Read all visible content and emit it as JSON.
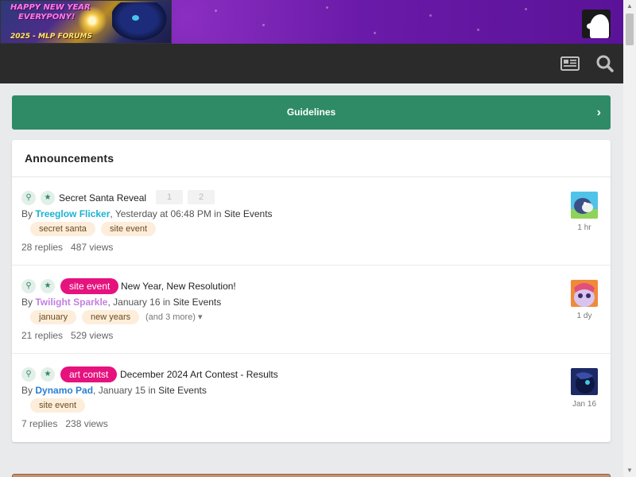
{
  "header": {
    "logo_line1": "HAPPY NEW YEAR",
    "logo_line2": "EVERYPONY!",
    "logo_line3": "2025 - MLP FORUMS"
  },
  "guidelines": {
    "label": "Guidelines",
    "chevron": "›"
  },
  "announcements": {
    "title": "Announcements",
    "topics": [
      {
        "title": "Secret Santa Reveal",
        "prefix": null,
        "pages": [
          "1",
          "2"
        ],
        "by": "By",
        "author": "Treeglow Flicker",
        "author_color": "#1ab4d2",
        "time": ", Yesterday at 06:48 PM",
        "in": "in",
        "forum": "Site Events",
        "tags": [
          "secret santa",
          "site event"
        ],
        "more_tags": "",
        "replies": "28 replies",
        "views": "487 views",
        "last_time": "1 hr"
      },
      {
        "title": "New Year, New Resolution!",
        "prefix": "site event",
        "by": "By",
        "author": "Twilight Sparkle",
        "author_color": "#c27fe0",
        "time": ", January 16",
        "in": "in",
        "forum": "Site Events",
        "tags": [
          "january",
          "new years"
        ],
        "more_tags": "(and 3 more)",
        "replies": "21 replies",
        "views": "529 views",
        "last_time": "1 dy"
      },
      {
        "title": "December 2024 Art Contest - Results",
        "prefix": "art contst",
        "by": "By",
        "author": "Dynamo Pad",
        "author_color": "#2a7fd1",
        "time": ", January 15",
        "in": "in",
        "forum": "Site Events",
        "tags": [
          "site event"
        ],
        "more_tags": "",
        "replies": "7 replies",
        "views": "238 views",
        "last_time": "Jan 16"
      }
    ]
  },
  "colors": {
    "header_purple": "#6a1aa8",
    "nav_dark": "#2b2b2b",
    "guidelines_green": "#2e8b66",
    "prefix_pink": "#e6127e",
    "tag_bg": "#fdeedb"
  },
  "icons": {
    "pin": "pin-icon",
    "featured": "star-icon",
    "activity": "newspaper-icon",
    "search": "search-icon"
  }
}
